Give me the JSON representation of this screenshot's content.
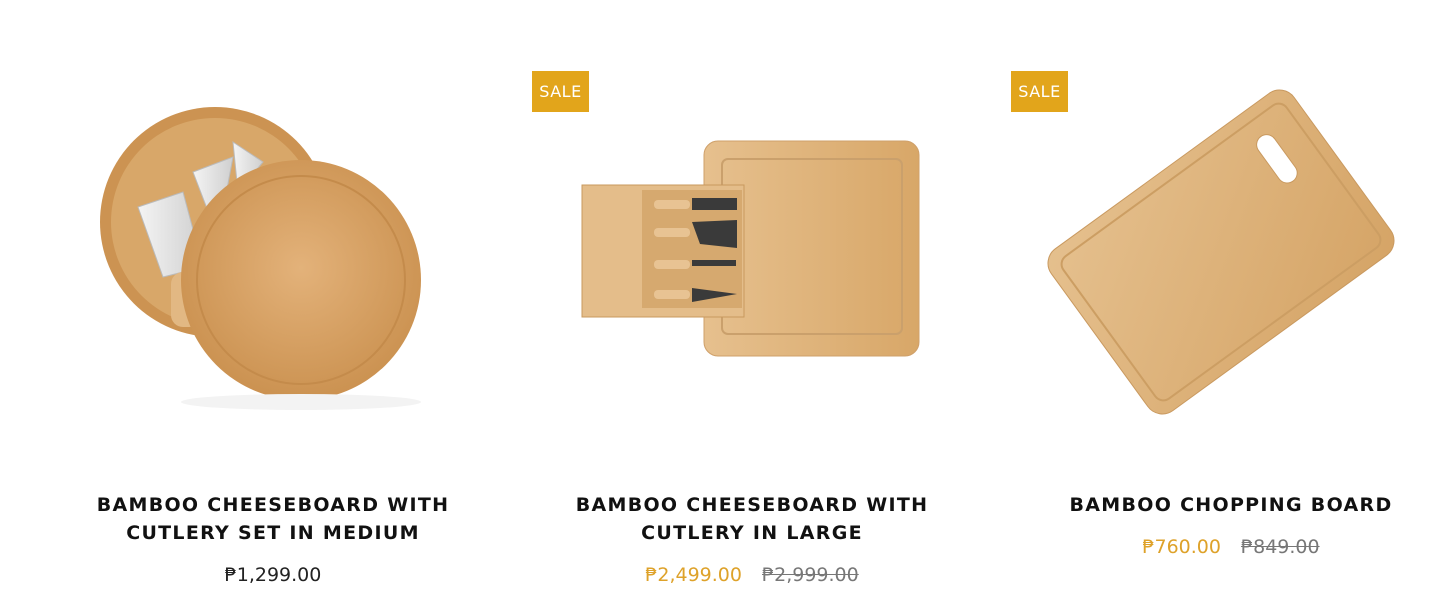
{
  "products": [
    {
      "title": "BAMBOO CHEESEBOARD WITH CUTLERY SET IN MEDIUM",
      "price": "₱1,299.00",
      "image_alt": "round bamboo cheeseboard with cutlery"
    },
    {
      "badge": "SALE",
      "title": "BAMBOO CHEESEBOARD WITH CUTLERY IN LARGE",
      "sale_price": "₱2,499.00",
      "original_price": "₱2,999.00",
      "image_alt": "square bamboo cheeseboard with drawer of knives"
    },
    {
      "badge": "SALE",
      "title": "BAMBOO CHOPPING BOARD",
      "sale_price": "₱760.00",
      "original_price": "₱849.00",
      "image_alt": "rectangular bamboo chopping board with handle"
    }
  ],
  "colors": {
    "sale_badge": "#e2a51b",
    "sale_price": "#dea22a",
    "bamboo": "#d9a766"
  }
}
